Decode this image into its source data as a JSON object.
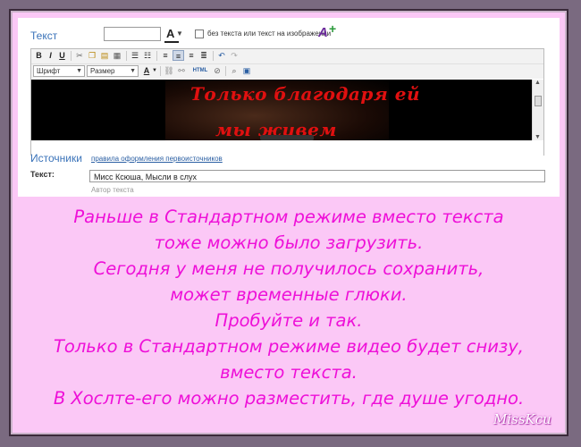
{
  "form": {
    "text_label": "Текст",
    "font_color_glyph": "A",
    "checkbox_label": "без текста или текст на изображении",
    "checkbox_checked": false,
    "add_font_icon_glyph": "A",
    "add_font_plus_glyph": "+",
    "toolbar": {
      "bold": "B",
      "italic": "I",
      "underline": "U",
      "font_select": "Шрифт",
      "size_select": "Размер",
      "color_glyph": "A",
      "html_label": "HTML"
    },
    "video": {
      "line1": "Только благодаря ей",
      "line2": "мы живем"
    },
    "sources_label": "Источники",
    "sources_link": "правила оформления первоисточников",
    "author_label": "Текст:",
    "author_value": "Мисс Ксюша, Мысли в слух",
    "author_hint": "Автор текста"
  },
  "message": [
    "Раньше в Стандартном режиме вместо текста",
    "тоже можно было загрузить.",
    "Сегодня у меня не получилось сохранить,",
    "может временные глюки.",
    "Пробуйте и так.",
    "Только в Стандартном режиме видео будет снизу,",
    "вместо текста.",
    "В Хослте-его можно разместить, где душе угодно."
  ],
  "signature": "MissKcu",
  "colors": {
    "background_pink": "#fbc8f6",
    "message_magenta": "#ee10d8",
    "link_blue": "#3b73b9",
    "video_text_red": "#e01010"
  }
}
